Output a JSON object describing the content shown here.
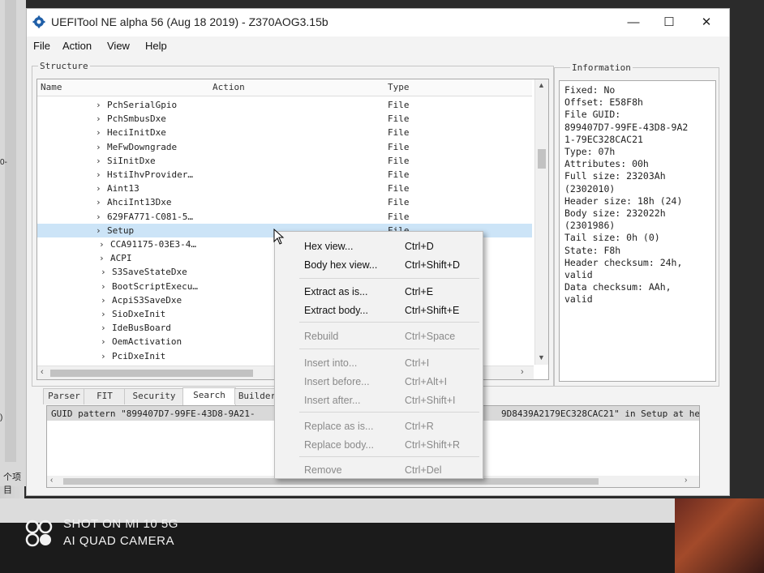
{
  "window": {
    "title": "UEFITool NE alpha 56 (Aug 18 2019) - Z370AOG3.15b",
    "minimize": "—",
    "maximize": "☐",
    "close": "✕"
  },
  "menu": [
    "File",
    "Action",
    "View",
    "Help"
  ],
  "structure": {
    "label": "Structure",
    "columns": {
      "name": "Name",
      "action": "Action",
      "type": "Type"
    },
    "rows": [
      {
        "name": "PchSerialGpio",
        "type": "File"
      },
      {
        "name": "PchSmbusDxe",
        "type": "File"
      },
      {
        "name": "HeciInitDxe",
        "type": "File"
      },
      {
        "name": "MeFwDowngrade",
        "type": "File"
      },
      {
        "name": "SiInitDxe",
        "type": "File"
      },
      {
        "name": "HstiIhvProvider…",
        "type": "File"
      },
      {
        "name": "Aint13",
        "type": "File"
      },
      {
        "name": "AhciInt13Dxe",
        "type": "File"
      },
      {
        "name": "629FA771-C081-5…",
        "type": "File"
      },
      {
        "name": "Setup",
        "type": "File",
        "selected": true
      },
      {
        "name": "CCA91175-03E3-4…",
        "type": ""
      },
      {
        "name": "ACPI",
        "type": ""
      },
      {
        "name": "S3SaveStateDxe",
        "type": ""
      },
      {
        "name": "BootScriptExecu…",
        "type": ""
      },
      {
        "name": "AcpiS3SaveDxe",
        "type": ""
      },
      {
        "name": "SioDxeInit",
        "type": ""
      },
      {
        "name": "IdeBusBoard",
        "type": ""
      },
      {
        "name": "OemActivation",
        "type": ""
      },
      {
        "name": "PciDxeInit",
        "type": ""
      }
    ]
  },
  "information": {
    "label": "Information",
    "lines": [
      "Fixed: No",
      "Offset: E58F8h",
      "File GUID:",
      "899407D7-99FE-43D8-9A2",
      "1-79EC328CAC21",
      "Type: 07h",
      "Attributes: 00h",
      "Full size: 23203Ah",
      "(2302010)",
      "Header size: 18h (24)",
      "Body size: 232022h",
      "(2301986)",
      "Tail size: 0h (0)",
      "State: F8h",
      "Header checksum: 24h,",
      "valid",
      "Data checksum: AAh,",
      "valid"
    ]
  },
  "tabs": [
    "Parser",
    "FIT",
    "Security",
    "Search",
    "Builder"
  ],
  "messages": {
    "left": "GUID pattern \"899407D7-99FE-43D8-9A21-",
    "right": "9D8439A2179EC328CAC21\" in Setup at he"
  },
  "context_menu": [
    {
      "label": "Hex view...",
      "shortcut": "Ctrl+D",
      "enabled": true
    },
    {
      "label": "Body hex view...",
      "shortcut": "Ctrl+Shift+D",
      "enabled": true
    },
    {
      "label": "Extract as is...",
      "shortcut": "Ctrl+E",
      "enabled": true
    },
    {
      "label": "Extract body...",
      "shortcut": "Ctrl+Shift+E",
      "enabled": true
    },
    {
      "label": "Rebuild",
      "shortcut": "Ctrl+Space",
      "enabled": false
    },
    {
      "label": "Insert into...",
      "shortcut": "Ctrl+I",
      "enabled": false
    },
    {
      "label": "Insert before...",
      "shortcut": "Ctrl+Alt+I",
      "enabled": false
    },
    {
      "label": "Insert after...",
      "shortcut": "Ctrl+Shift+I",
      "enabled": false
    },
    {
      "label": "Replace as is...",
      "shortcut": "Ctrl+R",
      "enabled": false
    },
    {
      "label": "Replace body...",
      "shortcut": "Ctrl+Shift+R",
      "enabled": false
    },
    {
      "label": "Remove",
      "shortcut": "Ctrl+Del",
      "enabled": false
    }
  ],
  "background": {
    "taskbar_text": "个项目"
  },
  "watermark": {
    "line1": "SHOT ON MI 10 5G",
    "line2": "AI QUAD CAMERA"
  },
  "colors": {
    "selection": "#cce4f7",
    "menu_bg": "#f2f2f2",
    "disabled_text": "#8a8a8a"
  }
}
